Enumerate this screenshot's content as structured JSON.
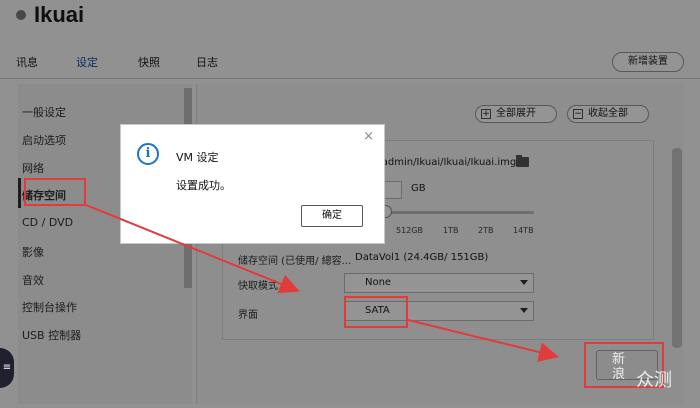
{
  "app": {
    "title": "Ikuai"
  },
  "tabs": [
    {
      "label": "讯息"
    },
    {
      "label": "设定"
    },
    {
      "label": "快照"
    },
    {
      "label": "日志"
    }
  ],
  "header": {
    "new_device": "新增装置"
  },
  "sidebar": {
    "items": [
      {
        "label": "一般设定"
      },
      {
        "label": "启动选项"
      },
      {
        "label": "网络"
      },
      {
        "label": "储存空间"
      },
      {
        "label": "CD / DVD"
      },
      {
        "label": "影像"
      },
      {
        "label": "音效"
      },
      {
        "label": "控制台操作"
      },
      {
        "label": "USB 控制器"
      }
    ],
    "active": "储存空间"
  },
  "main": {
    "expand_all": "全部展开",
    "collapse_all": "收起全部",
    "image_path": "es/admin/Ikuai/Ikuai/Ikuai.img",
    "size_unit": "GB",
    "slider_ticks": [
      "512GB",
      "1TB",
      "2TB",
      "14TB"
    ],
    "storage_label": "储存空间 (已使用/ 總容...",
    "storage_value": "DataVol1 (24.4GB/ 151GB)",
    "cache_label": "快取模式",
    "cache_value": "None",
    "interface_label": "界面",
    "interface_value": "SATA"
  },
  "dialog": {
    "title": "VM 设定",
    "message": "设置成功。",
    "ok": "确定"
  },
  "watermark": {
    "line1": "新",
    "line2": "浪",
    "text": "众测"
  },
  "colors": {
    "annotation": "#e23b3b",
    "info": "#1e72c8"
  }
}
